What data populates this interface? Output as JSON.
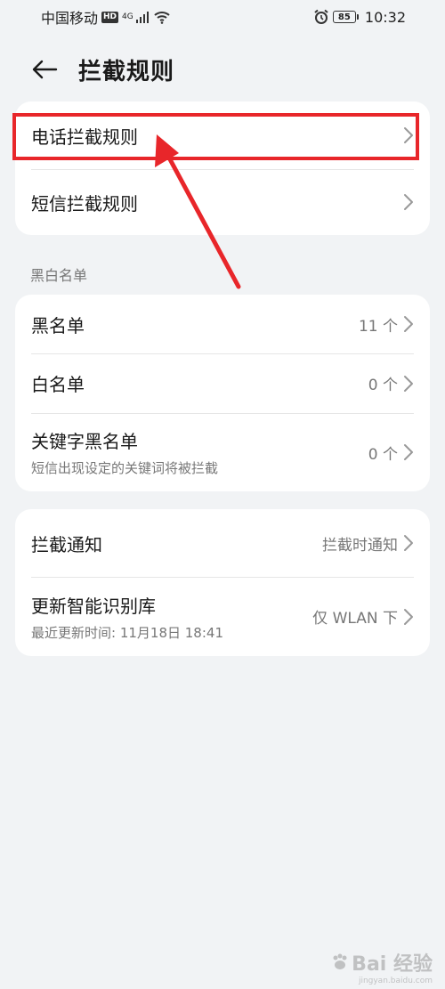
{
  "status_bar": {
    "carrier": "中国移动",
    "hd": "HD",
    "network": "4G",
    "battery": "85",
    "time": "10:32"
  },
  "header": {
    "title": "拦截规则"
  },
  "intercept_rules": [
    {
      "title": "电话拦截规则"
    },
    {
      "title": "短信拦截规则"
    }
  ],
  "blackwhite": {
    "section_label": "黑白名单",
    "items": [
      {
        "title": "黑名单",
        "value": "11 个"
      },
      {
        "title": "白名单",
        "value": "0 个"
      },
      {
        "title": "关键字黑名单",
        "subtitle": "短信出现设定的关键词将被拦截",
        "value": "0 个"
      }
    ]
  },
  "other": {
    "items": [
      {
        "title": "拦截通知",
        "value": "拦截时通知"
      },
      {
        "title": "更新智能识别库",
        "subtitle": "最近更新时间: 11月18日 18:41",
        "value": "仅 WLAN 下"
      }
    ]
  },
  "annotation": {
    "color": "#e8262a"
  },
  "watermark": {
    "text": "Bai 经验",
    "sub": "jingyan.baidu.com"
  }
}
